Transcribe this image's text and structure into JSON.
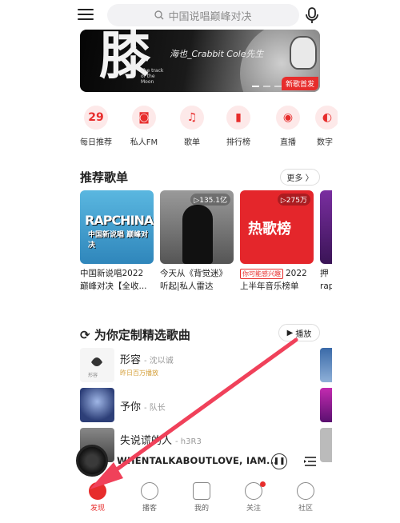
{
  "header": {
    "search_placeholder": "中国说唱巅峰对决"
  },
  "banner": {
    "big_char": "膝",
    "subtitle": "海也_Crabbit Cole先生",
    "caption": "The track of the Moon",
    "badge": "新歌首发"
  },
  "quick_entries": [
    {
      "label": "每日推荐",
      "icon": "calendar-icon",
      "glyph": "29"
    },
    {
      "label": "私人FM",
      "icon": "radio-icon",
      "glyph": "◙"
    },
    {
      "label": "歌单",
      "icon": "playlist-icon",
      "glyph": "♫"
    },
    {
      "label": "排行榜",
      "icon": "chart-bars-icon",
      "glyph": "▮"
    },
    {
      "label": "直播",
      "icon": "live-icon",
      "glyph": "◉"
    },
    {
      "label": "数字",
      "icon": "digital-icon",
      "glyph": "◐"
    }
  ],
  "recommend": {
    "title": "推荐歌单",
    "more": "更多 〉",
    "playlists": [
      {
        "line1": "中国新说唱2022",
        "line2": "巅峰对决【全收...",
        "cover_text": "RAPCHINA",
        "cover_text2": "中国新说唱 巅峰对决",
        "plays": ""
      },
      {
        "line1": "今天从《背觉迷》",
        "line2": "听起|私人雷达",
        "cover_text": "",
        "plays": "▷135.1亿"
      },
      {
        "line1": "2022",
        "line2": "上半年音乐榜单",
        "tag": "你可能感兴趣",
        "cover_text": "热歌榜",
        "plays": "▷275万"
      },
      {
        "line1": "押",
        "line2": "rap",
        "cover_text": "",
        "plays": ""
      }
    ]
  },
  "custom": {
    "title": "为你定制精选歌曲",
    "play_label": "播放",
    "songs": [
      {
        "name": "形容",
        "singer": "- 沈以诚",
        "hint": "昨日百万播放"
      },
      {
        "name": "予你",
        "singer": "- 队长",
        "hint": ""
      },
      {
        "name": "失说谎的人",
        "singer": "- h3R3",
        "hint": ""
      }
    ]
  },
  "player": {
    "title": "WHENTALKABOUTLOVE, IAM..."
  },
  "nav": [
    {
      "label": "发现",
      "icon": "discover-icon"
    },
    {
      "label": "播客",
      "icon": "podcast-icon"
    },
    {
      "label": "我的",
      "icon": "music-note-icon"
    },
    {
      "label": "关注",
      "icon": "follow-icon"
    },
    {
      "label": "社区",
      "icon": "community-icon"
    }
  ],
  "colors": {
    "accent": "#e72d2c",
    "annotation_arrow": "#f0415a"
  }
}
